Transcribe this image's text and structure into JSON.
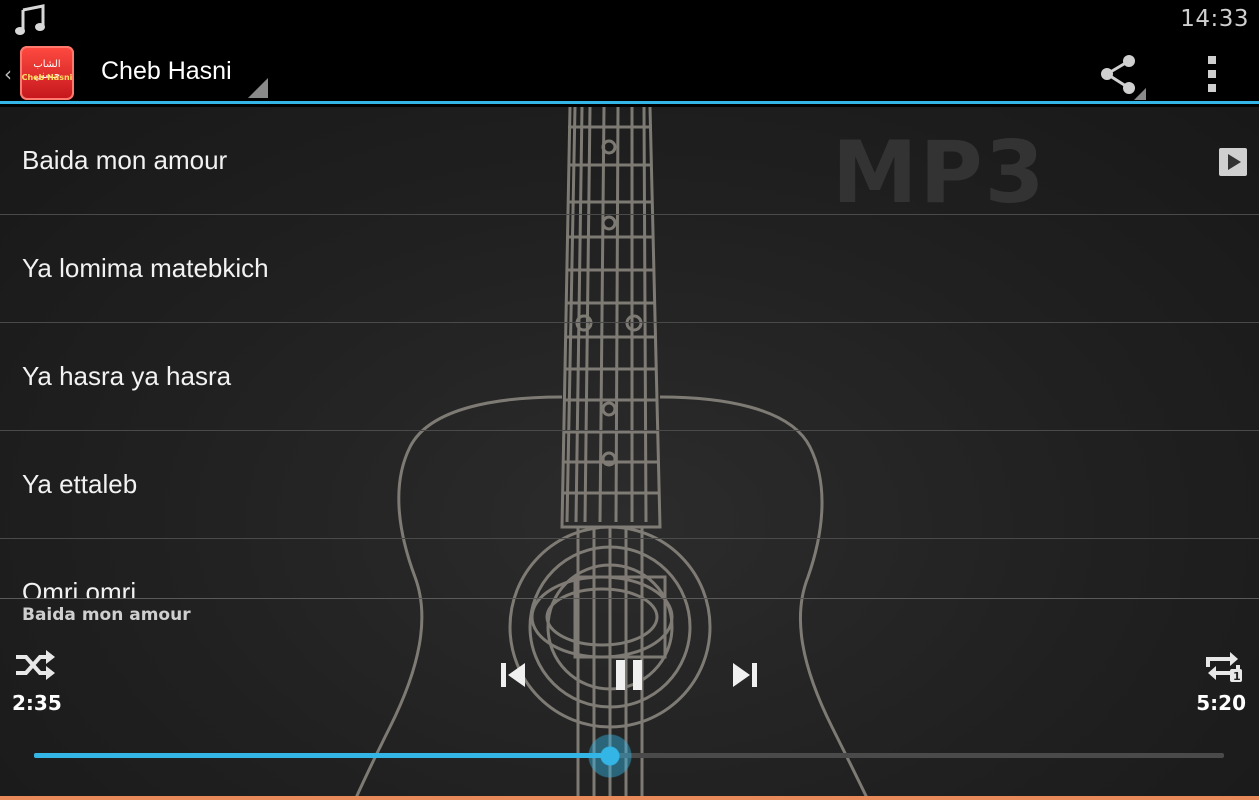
{
  "status_bar": {
    "time": "14:33",
    "notification_icon": "music-note-icon"
  },
  "action_bar": {
    "title": "Cheb Hasni",
    "app_icon_text_arabic": "الشاب حسني",
    "app_icon_text_latin": "Cheb Hasni",
    "icons": [
      "up-caret-icon",
      "app-icon",
      "share-icon",
      "overflow-menu-icon"
    ],
    "accent_color": "#33b5e5"
  },
  "background": {
    "watermark": "MP3"
  },
  "songs": [
    {
      "title": "Baida mon amour",
      "playing": true
    },
    {
      "title": "Ya lomima matebkich"
    },
    {
      "title": "Ya hasra ya hasra"
    },
    {
      "title": "Ya ettaleb"
    },
    {
      "title": "Omri omri"
    }
  ],
  "player": {
    "now_playing": "Baida mon amour",
    "current_time": "2:35",
    "total_time": "5:20",
    "progress": 0.484,
    "controls": [
      "shuffle-icon",
      "previous-icon",
      "pause-icon",
      "next-icon",
      "repeat-one-icon"
    ]
  }
}
